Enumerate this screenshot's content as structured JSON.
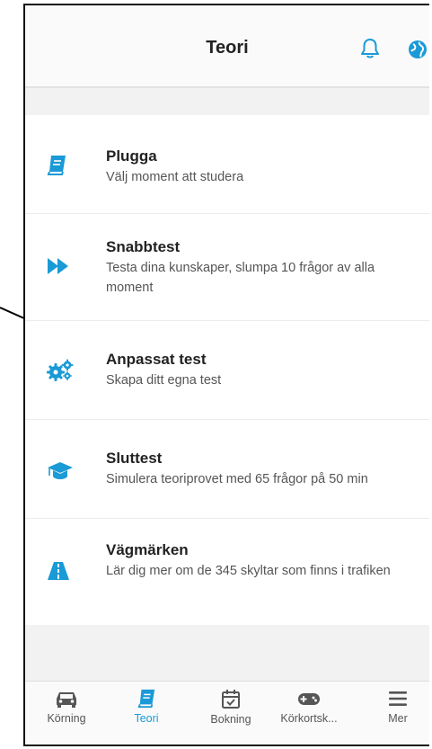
{
  "header": {
    "title": "Teori"
  },
  "items": [
    {
      "title": "Plugga",
      "subtitle": "Välj moment att studera",
      "icon": "book-icon"
    },
    {
      "title": "Snabbtest",
      "subtitle": "Testa dina kunskaper, slumpa 10 frågor av alla moment",
      "icon": "fast-forward-icon"
    },
    {
      "title": "Anpassat test",
      "subtitle": "Skapa ditt egna test",
      "icon": "gears-icon"
    },
    {
      "title": "Sluttest",
      "subtitle": "Simulera teoriprovet med 65 frågor på 50 min",
      "icon": "graduation-cap-icon"
    },
    {
      "title": "Vägmärken",
      "subtitle": "Lär dig mer om de 345 skyltar som finns i trafiken",
      "icon": "road-icon"
    }
  ],
  "tabs": [
    {
      "label": "Körning",
      "icon": "car-icon",
      "active": false
    },
    {
      "label": "Teori",
      "icon": "book-icon",
      "active": true
    },
    {
      "label": "Bokning",
      "icon": "calendar-check-icon",
      "active": false
    },
    {
      "label": "Körkortsk...",
      "icon": "gamepad-icon",
      "active": false
    },
    {
      "label": "Mer",
      "icon": "menu-icon",
      "active": false
    }
  ],
  "colors": {
    "accent": "#1a9ad6",
    "text": "#222222",
    "muted": "#555555",
    "tab_inactive": "#555555"
  }
}
